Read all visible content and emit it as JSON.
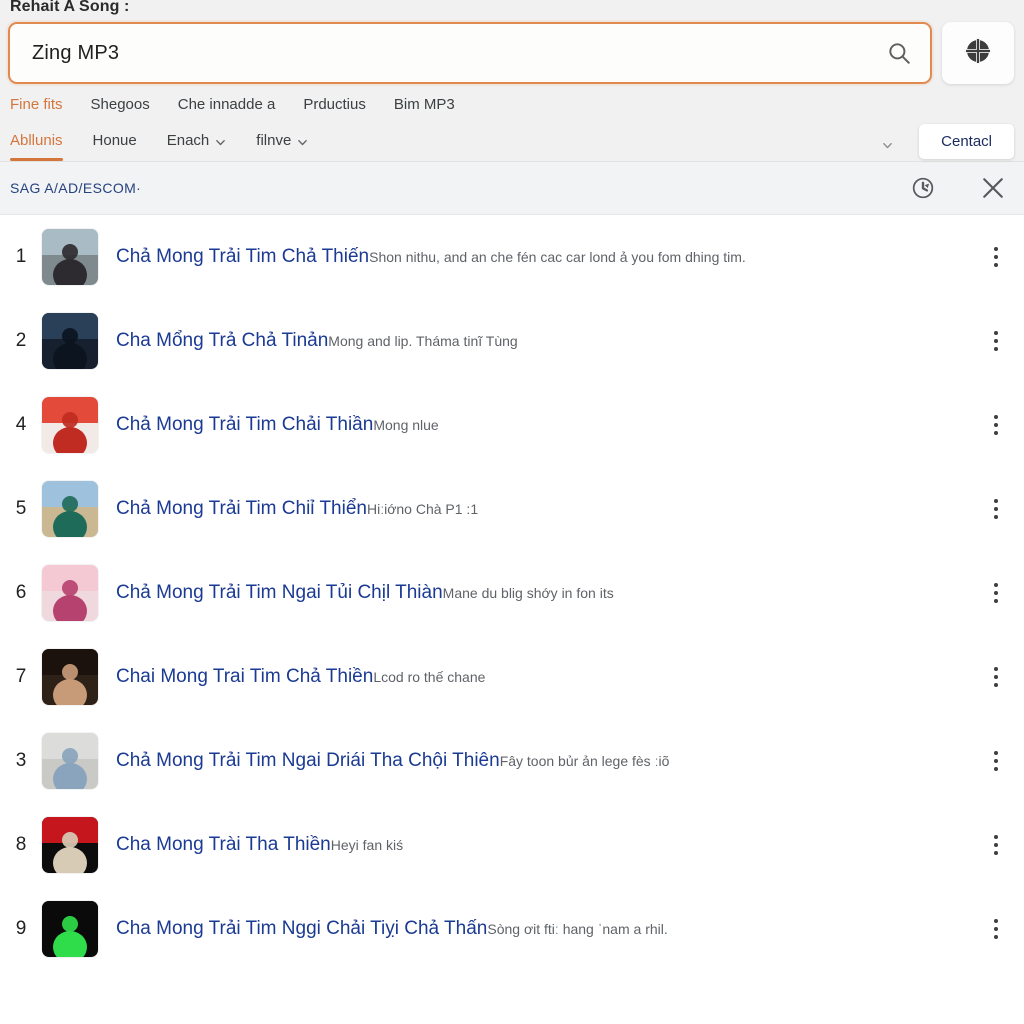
{
  "header": {
    "title": "Rehait A Song :",
    "search": {
      "value": "Zing MP3",
      "icon": "search-icon"
    },
    "apps_button_icon": "compass-grid-icon"
  },
  "nav_primary": [
    {
      "label": "Fine fits",
      "active": true
    },
    {
      "label": "Shegoos",
      "active": false
    },
    {
      "label": "Che innadde a",
      "active": false
    },
    {
      "label": "Prductius",
      "active": false
    },
    {
      "label": "Bim MP3",
      "active": false
    }
  ],
  "nav_secondary": {
    "items": [
      {
        "label": "Abllunis",
        "active": true,
        "has_chevron": false
      },
      {
        "label": "Honue",
        "active": false,
        "has_chevron": false
      },
      {
        "label": "Enach",
        "active": false,
        "has_chevron": true
      },
      {
        "label": "filnve",
        "active": false,
        "has_chevron": true
      }
    ],
    "overflow_icon": "chevron-down-icon",
    "contact_label": "Centacl"
  },
  "results_bar": {
    "label": "SAG A/AD/ESCOM·",
    "history_icon": "history-clock-icon",
    "close_icon": "close-icon"
  },
  "results": [
    {
      "rank": "1",
      "title": "Chả Mong Trải Tim Chả Thiến",
      "subtitle": "Shon nithu, and an che fén cac car lond ả you fom dhing tim.",
      "thumb": {
        "name": "portrait-woman-mountain-thumb",
        "bg": "#7e8a8e",
        "fg": "#2e2b30",
        "sky": "#a9bcc6"
      }
    },
    {
      "rank": "2",
      "title": "Cha Mổng Trả Chả Tinản",
      "subtitle": "Mong and lip. Tháma tinĩ Tùng",
      "thumb": {
        "name": "night-city-road-thumb",
        "bg": "#16202e",
        "fg": "#0c1420",
        "sky": "#2a4059"
      }
    },
    {
      "rank": "4",
      "title": "Chả Mong Trải Tim Chải Thiần",
      "subtitle": "Mong nlue",
      "thumb": {
        "name": "red-poster-thumb",
        "bg": "#f2eae6",
        "fg": "#c02b22",
        "sky": "#e44a3a"
      }
    },
    {
      "rank": "5",
      "title": "Chả Mong Trải Tim Chiỉ Thiển",
      "subtitle": "Hiːiớno Chà P1 :1",
      "thumb": {
        "name": "man-green-shirt-field-thumb",
        "bg": "#c9b892",
        "fg": "#1f6b5a",
        "sky": "#9ec2dd"
      }
    },
    {
      "rank": "6",
      "title": "Chả Mong Trải Tim Ngai Tủi Chịl Thiàn",
      "subtitle": "Mane du blig shớy in fon its",
      "thumb": {
        "name": "pink-collage-thumb",
        "bg": "#efd8de",
        "fg": "#b6436f",
        "sky": "#f4c9d4"
      }
    },
    {
      "rank": "7",
      "title": "Chai Mong Trai Tim Chả Thiền",
      "subtitle": "Lcod ro thế chane",
      "thumb": {
        "name": "man-portrait-dark-thumb",
        "bg": "#2e2118",
        "fg": "#c79a78",
        "sky": "#1b120d"
      }
    },
    {
      "rank": "3",
      "title": "Chả Mong Trải Tim Ngai Driái Tha Chội Thiên",
      "subtitle": "Fây toon bủr ản lege fès ːiõ",
      "thumb": {
        "name": "man-blue-shirt-grey-thumb",
        "bg": "#c9c9c6",
        "fg": "#8aa4bd",
        "sky": "#dcdcda"
      }
    },
    {
      "rank": "8",
      "title": "Cha Mong Trài Tha Thiền",
      "subtitle": "Heyi fan kiś",
      "thumb": {
        "name": "barchna-black-red-thumb",
        "bg": "#0c0c0c",
        "fg": "#d8cbb6",
        "sky": "#c4161c"
      }
    },
    {
      "rank": "9",
      "title": "Cha Mong Trải Tim Nggi Chải Tiỵi Chả Thấn",
      "subtitle": "Sòng ơit ftiː hang ˈnam a rhil.",
      "thumb": {
        "name": "green-text-black-thumb",
        "bg": "#0a0a0a",
        "fg": "#2fdc4a",
        "sky": "#0a0a0a"
      }
    }
  ],
  "colors": {
    "accent": "#d4763c",
    "link": "#1a3a93",
    "header_bg": "#f1f1f1",
    "results_bar_bg": "#f1f3f4"
  }
}
